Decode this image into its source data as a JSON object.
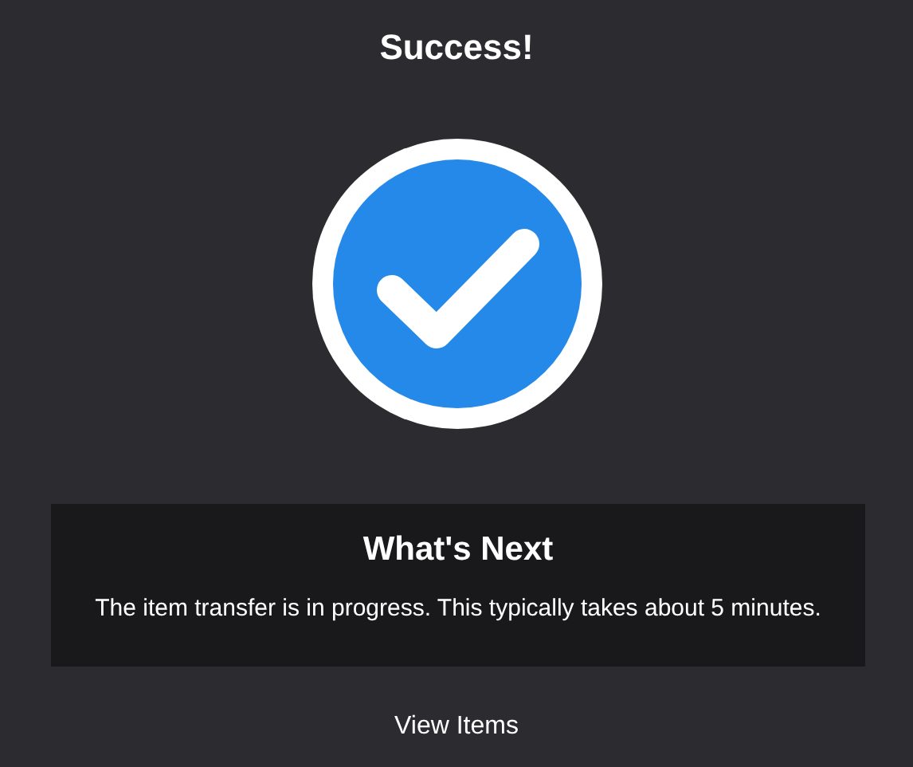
{
  "title": "Success!",
  "next": {
    "heading": "What's Next",
    "text": "The item transfer is in progress. This typically takes about 5 minutes."
  },
  "link": "View Items"
}
